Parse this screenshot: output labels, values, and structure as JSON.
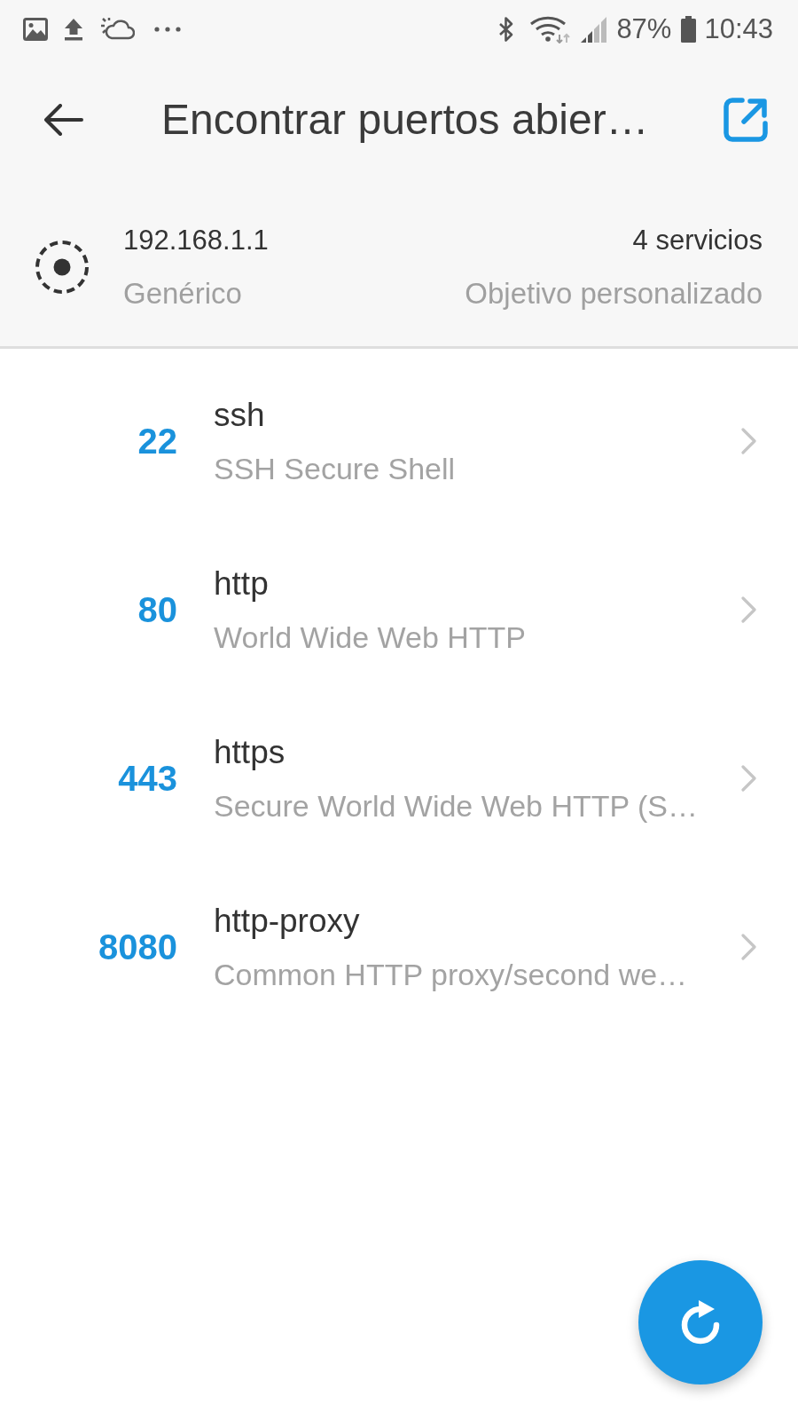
{
  "status_bar": {
    "battery": "87%",
    "time": "10:43"
  },
  "app_bar": {
    "title": "Encontrar puertos abier…"
  },
  "target": {
    "address": "192.168.1.1",
    "type": "Genérico",
    "services": "4 servicios",
    "category": "Objetivo personalizado"
  },
  "ports": [
    {
      "port": "22",
      "service": "ssh",
      "description": "SSH Secure Shell"
    },
    {
      "port": "80",
      "service": "http",
      "description": "World Wide Web HTTP"
    },
    {
      "port": "443",
      "service": "https",
      "description": "Secure World Wide Web HTTP (S…"
    },
    {
      "port": "8080",
      "service": "http-proxy",
      "description": "Common HTTP proxy/second we…"
    }
  ]
}
